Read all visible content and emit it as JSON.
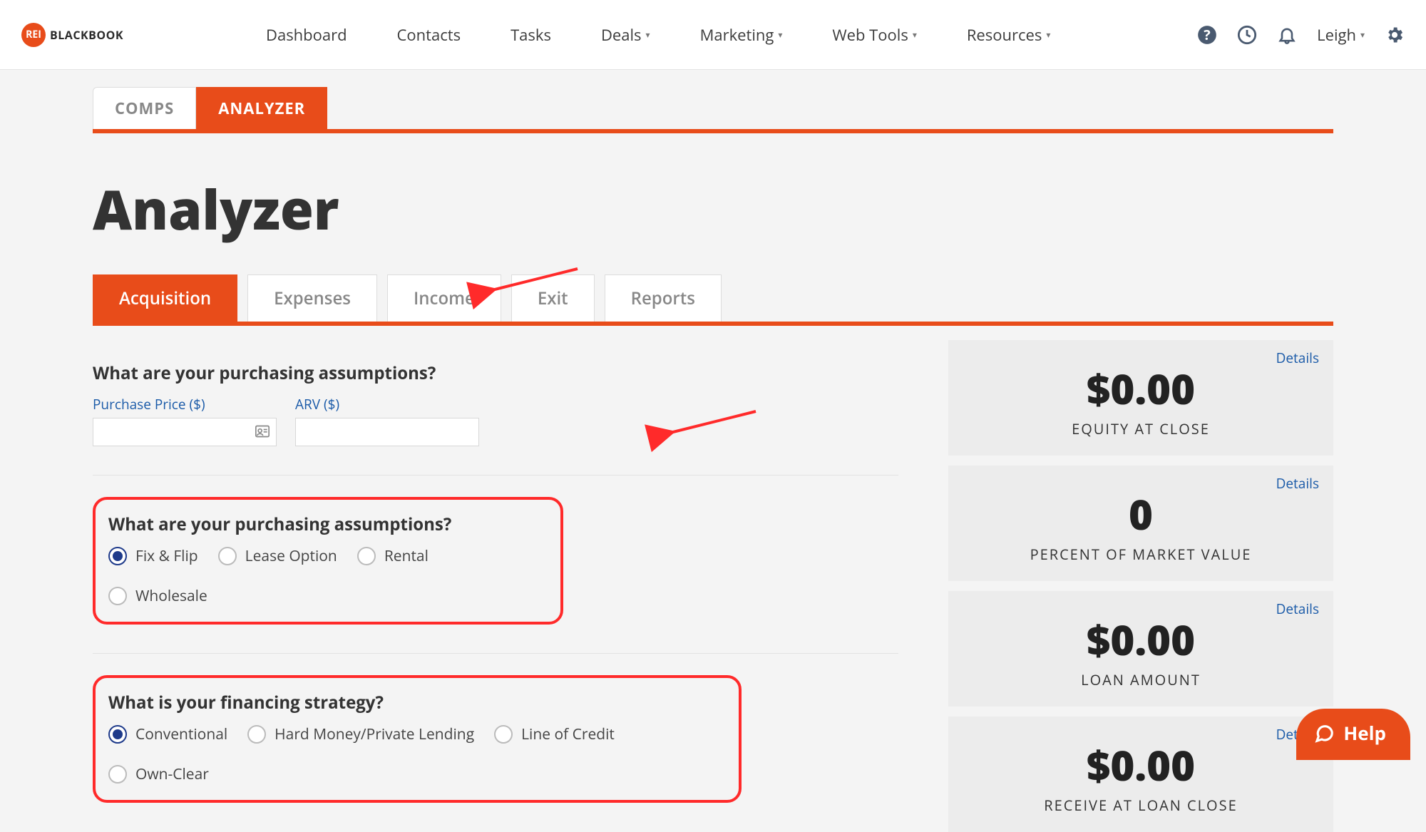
{
  "brand": {
    "badge": "REI",
    "name": "BLACKBOOK"
  },
  "nav": {
    "dashboard": "Dashboard",
    "contacts": "Contacts",
    "tasks": "Tasks",
    "deals": "Deals",
    "marketing": "Marketing",
    "webtools": "Web Tools",
    "resources": "Resources"
  },
  "user": {
    "name": "Leigh"
  },
  "topTabs": {
    "comps": "COMPS",
    "analyzer": "ANALYZER"
  },
  "pageTitle": "Analyzer",
  "subTabs": {
    "acquisition": "Acquisition",
    "expenses": "Expenses",
    "income": "Income",
    "exit": "Exit",
    "reports": "Reports"
  },
  "section1": {
    "question": "What are your purchasing assumptions?",
    "purchasePriceLabel": "Purchase Price ($)",
    "arvLabel": "ARV ($)",
    "purchasePriceValue": "",
    "arvValue": ""
  },
  "section2": {
    "question": "What are your purchasing assumptions?",
    "options": {
      "fixflip": "Fix & Flip",
      "lease": "Lease Option",
      "rental": "Rental",
      "wholesale": "Wholesale"
    },
    "selected": "fixflip"
  },
  "section3": {
    "question": "What is your financing strategy?",
    "options": {
      "conventional": "Conventional",
      "hardmoney": "Hard Money/Private Lending",
      "loc": "Line of Credit",
      "ownclear": "Own-Clear"
    },
    "selected": "conventional"
  },
  "summary": {
    "detailsLabel": "Details",
    "cards": [
      {
        "value": "$0.00",
        "caption": "EQUITY AT CLOSE"
      },
      {
        "value": "0",
        "caption": "PERCENT OF MARKET VALUE"
      },
      {
        "value": "$0.00",
        "caption": "LOAN AMOUNT"
      },
      {
        "value": "$0.00",
        "caption": "RECEIVE AT LOAN CLOSE"
      }
    ]
  },
  "help": {
    "label": "Help"
  }
}
